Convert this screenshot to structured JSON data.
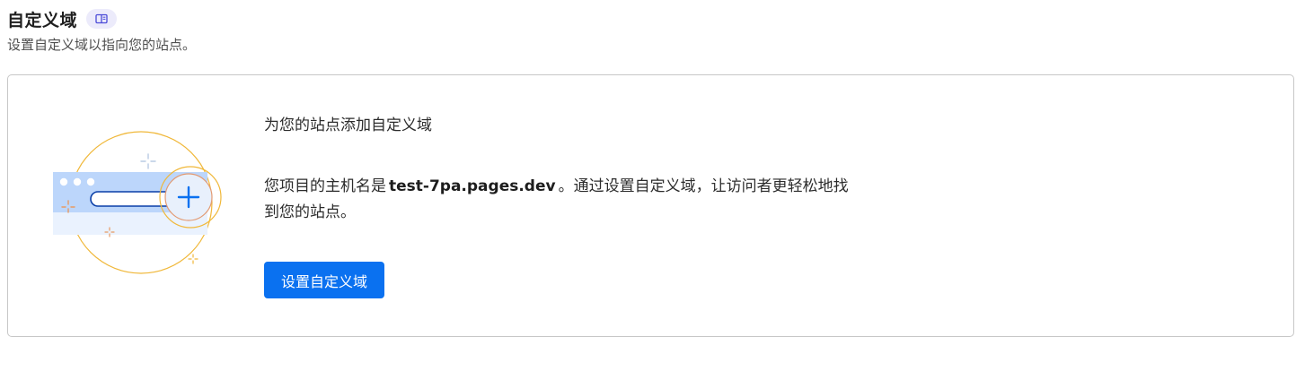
{
  "section": {
    "title": "自定义域",
    "doc_icon": "book-open-icon",
    "subtitle": "设置自定义域以指向您的站点。"
  },
  "card": {
    "heading": "为您的站点添加自定义域",
    "desc_prefix": "您项目的主机名是",
    "hostname": "test-7pa.pages.dev",
    "desc_suffix": "。通过设置自定义域，让访问者更轻松地找到您的站点。",
    "button_label": "设置自定义域",
    "illustration_icon": "browser-add-domain-illustration"
  },
  "colors": {
    "accent": "#0a71f0",
    "badge_bg": "#ecebfb",
    "border": "#c7c7c7",
    "illustration_ring": "#f0b83a",
    "illustration_blue": "#bcd6fb"
  }
}
